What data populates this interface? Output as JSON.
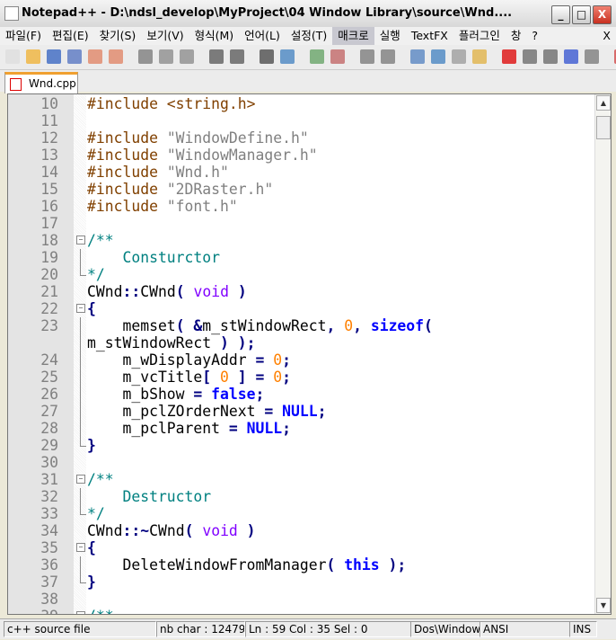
{
  "window": {
    "title": "Notepad++ - D:\\ndsl_develop\\MyProject\\04 Window Library\\source\\Wnd....",
    "minimize": "_",
    "maximize": "□",
    "close": "X"
  },
  "menu": [
    "파일(F)",
    "편집(E)",
    "찾기(S)",
    "보기(V)",
    "형식(M)",
    "언어(L)",
    "설정(T)",
    "매크로",
    "실행",
    "TextFX",
    "플러그인",
    "창",
    "?",
    "X"
  ],
  "menu_active": "매크로",
  "toolbar_icons": [
    "new-file-icon",
    "open-file-icon",
    "save-icon",
    "save-all-icon",
    "close-icon",
    "close-all-icon",
    "cut-icon",
    "copy-icon",
    "paste-icon",
    "undo-icon",
    "redo-icon",
    "find-icon",
    "replace-icon",
    "zoom-in-icon",
    "zoom-out-icon",
    "sync-v-icon",
    "sync-h-icon",
    "word-wrap-icon",
    "show-all-chars-icon",
    "indent-guide-icon",
    "user-lang-icon",
    "record-macro-icon",
    "stop-macro-icon",
    "play-macro-icon",
    "run-macro-multiple-icon",
    "save-macro-icon",
    "extra-icon"
  ],
  "tab": {
    "label": "Wnd.cpp"
  },
  "colors": {
    "preprocessor": "#804000",
    "string": "#808080",
    "comment": "#008080",
    "keyword": "#0000ff",
    "type": "#8000ff",
    "number": "#ff8000",
    "operator": "#000080"
  },
  "code": [
    {
      "n": "10",
      "t": [
        [
          "pp",
          "#include <string.h>"
        ]
      ]
    },
    {
      "n": "11",
      "t": []
    },
    {
      "n": "12",
      "t": [
        [
          "pp",
          "#include "
        ],
        [
          "str",
          "\"WindowDefine.h\""
        ]
      ]
    },
    {
      "n": "13",
      "t": [
        [
          "pp",
          "#include "
        ],
        [
          "str",
          "\"WindowManager.h\""
        ]
      ]
    },
    {
      "n": "14",
      "t": [
        [
          "pp",
          "#include "
        ],
        [
          "str",
          "\"Wnd.h\""
        ]
      ]
    },
    {
      "n": "15",
      "t": [
        [
          "pp",
          "#include "
        ],
        [
          "str",
          "\"2DRaster.h\""
        ]
      ]
    },
    {
      "n": "16",
      "t": [
        [
          "pp",
          "#include "
        ],
        [
          "str",
          "\"font.h\""
        ]
      ]
    },
    {
      "n": "17",
      "t": []
    },
    {
      "n": "18",
      "f": "m",
      "t": [
        [
          "cm",
          "/**"
        ]
      ]
    },
    {
      "n": "19",
      "f": "l",
      "t": [
        [
          "cm",
          "    Consturctor"
        ]
      ]
    },
    {
      "n": "20",
      "f": "e",
      "t": [
        [
          "cm",
          "*/"
        ]
      ]
    },
    {
      "n": "21",
      "t": [
        [
          "id",
          "CWnd"
        ],
        [
          "op",
          "::"
        ],
        [
          "id",
          "CWnd"
        ],
        [
          "op",
          "( "
        ],
        [
          "ty",
          "void"
        ],
        [
          "op",
          " )"
        ]
      ]
    },
    {
      "n": "22",
      "f": "m",
      "t": [
        [
          "op",
          "{"
        ]
      ]
    },
    {
      "n": "23",
      "f": "l",
      "t": [
        [
          "id",
          "    memset"
        ],
        [
          "op",
          "( &"
        ],
        [
          "id",
          "m_stWindowRect"
        ],
        [
          "op",
          ", "
        ],
        [
          "n",
          "0"
        ],
        [
          "op",
          ", "
        ],
        [
          "kw",
          "sizeof"
        ],
        [
          "op",
          "("
        ]
      ]
    },
    {
      "n": "",
      "f": "l",
      "t": [
        [
          "id",
          "m_stWindowRect"
        ],
        [
          "op",
          " ) );"
        ]
      ]
    },
    {
      "n": "24",
      "f": "l",
      "t": [
        [
          "id",
          "    m_wDisplayAddr "
        ],
        [
          "op",
          "= "
        ],
        [
          "n",
          "0"
        ],
        [
          "op",
          ";"
        ]
      ]
    },
    {
      "n": "25",
      "f": "l",
      "t": [
        [
          "id",
          "    m_vcTitle"
        ],
        [
          "op",
          "[ "
        ],
        [
          "n",
          "0"
        ],
        [
          "op",
          " ] = "
        ],
        [
          "n",
          "0"
        ],
        [
          "op",
          ";"
        ]
      ]
    },
    {
      "n": "26",
      "f": "l",
      "t": [
        [
          "id",
          "    m_bShow "
        ],
        [
          "op",
          "= "
        ],
        [
          "kw",
          "false"
        ],
        [
          "op",
          ";"
        ]
      ]
    },
    {
      "n": "27",
      "f": "l",
      "t": [
        [
          "id",
          "    m_pclZOrderNext "
        ],
        [
          "op",
          "= "
        ],
        [
          "kw",
          "NULL"
        ],
        [
          "op",
          ";"
        ]
      ]
    },
    {
      "n": "28",
      "f": "l",
      "t": [
        [
          "id",
          "    m_pclParent "
        ],
        [
          "op",
          "= "
        ],
        [
          "kw",
          "NULL"
        ],
        [
          "op",
          ";"
        ]
      ]
    },
    {
      "n": "29",
      "f": "e",
      "t": [
        [
          "op",
          "}"
        ]
      ]
    },
    {
      "n": "30",
      "t": []
    },
    {
      "n": "31",
      "f": "m",
      "t": [
        [
          "cm",
          "/**"
        ]
      ]
    },
    {
      "n": "32",
      "f": "l",
      "t": [
        [
          "cm",
          "    Destructor"
        ]
      ]
    },
    {
      "n": "33",
      "f": "e",
      "t": [
        [
          "cm",
          "*/"
        ]
      ]
    },
    {
      "n": "34",
      "t": [
        [
          "id",
          "CWnd"
        ],
        [
          "op",
          "::~"
        ],
        [
          "id",
          "CWnd"
        ],
        [
          "op",
          "( "
        ],
        [
          "ty",
          "void"
        ],
        [
          "op",
          " )"
        ]
      ]
    },
    {
      "n": "35",
      "f": "m",
      "t": [
        [
          "op",
          "{"
        ]
      ]
    },
    {
      "n": "36",
      "f": "l",
      "t": [
        [
          "id",
          "    DeleteWindowFromManager"
        ],
        [
          "op",
          "( "
        ],
        [
          "kw",
          "this"
        ],
        [
          "op",
          " );"
        ]
      ]
    },
    {
      "n": "37",
      "f": "e",
      "t": [
        [
          "op",
          "}"
        ]
      ]
    },
    {
      "n": "38",
      "t": []
    },
    {
      "n": "39",
      "f": "m",
      "t": [
        [
          "cm",
          "/**"
        ]
      ]
    }
  ],
  "status": {
    "lang": "c++ source file",
    "chars": "nb char : 12479",
    "pos": "Ln : 59    Col : 35    Sel : 0",
    "eol": "Dos\\Windows",
    "enc": "ANSI",
    "mode": "INS"
  }
}
